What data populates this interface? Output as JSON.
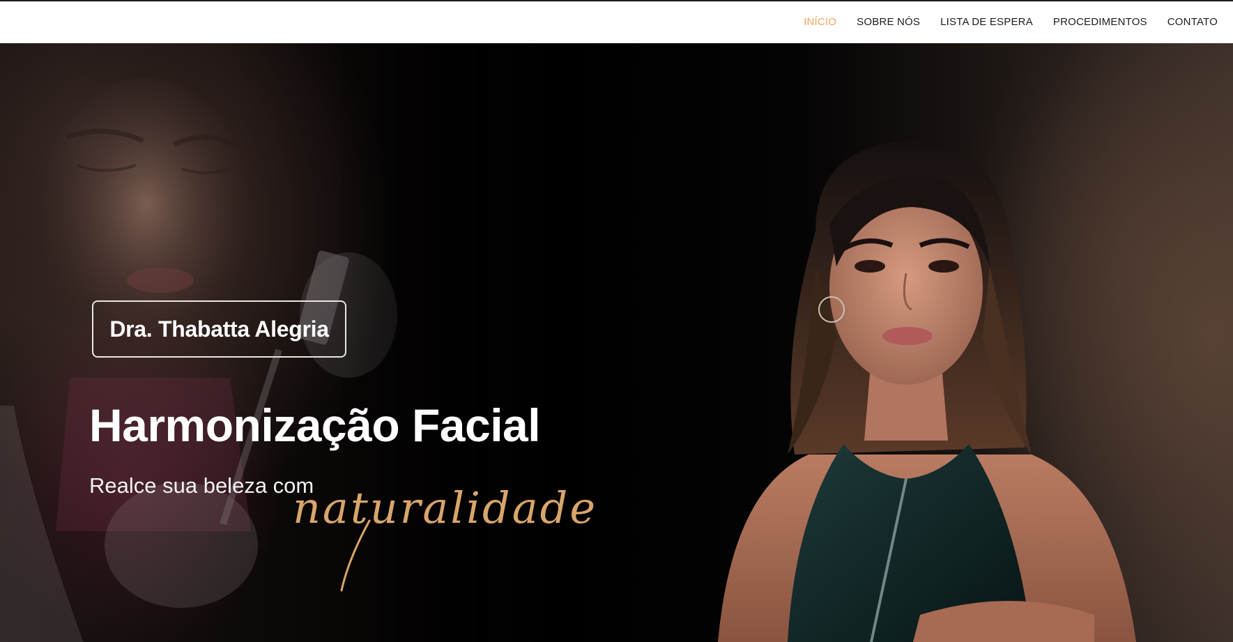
{
  "nav": {
    "items": [
      {
        "label": "INÍCIO",
        "active": true
      },
      {
        "label": "SOBRE NÓS",
        "active": false
      },
      {
        "label": "LISTA DE ESPERA",
        "active": false
      },
      {
        "label": "PROCEDIMENTOS",
        "active": false
      },
      {
        "label": "CONTATO",
        "active": false
      }
    ]
  },
  "hero": {
    "name": "Dra. Thabatta Alegria",
    "headline": "Harmonização Facial",
    "subline": "Realce sua beleza com",
    "script_word": "naturalidade"
  },
  "colors": {
    "accent": "#f0a35c",
    "script_gold": "#d9a56a",
    "header_bg": "#ffffff",
    "nav_text": "#1c1c1c"
  }
}
